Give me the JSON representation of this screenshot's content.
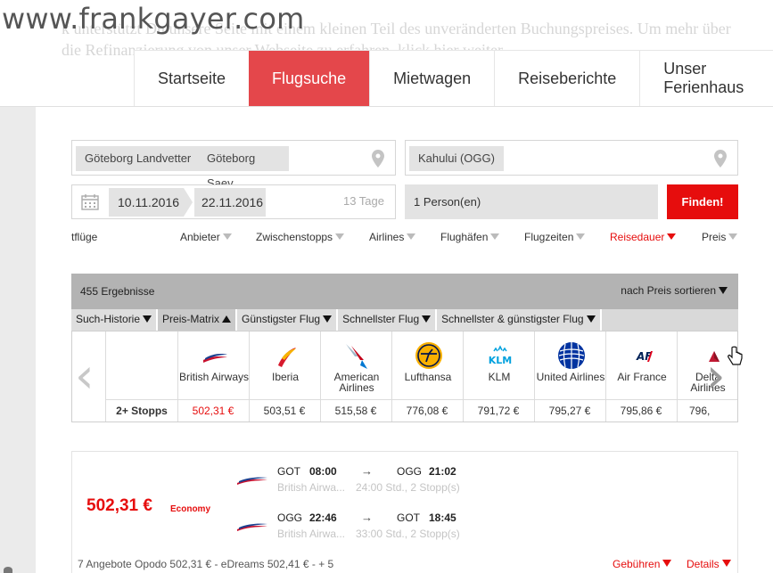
{
  "watermark": "www.frankgayer.com",
  "banner_text": "k unterstützt Du unsere Seite mit einem kleinen Teil des unveränderten Buchungspreises. Um mehr über die Refinanzierung von unser Webseite zu erfahren, klick hier weiter.",
  "nav": {
    "items": [
      {
        "label": "Startseite",
        "active": false
      },
      {
        "label": "Flugsuche",
        "active": true
      },
      {
        "label": "Mietwagen",
        "active": false
      },
      {
        "label": "Reiseberichte",
        "active": false
      },
      {
        "label": "Unser Ferienhaus",
        "active": false
      }
    ]
  },
  "search": {
    "origins": [
      "Göteborg Landvetter",
      "Göteborg Saev"
    ],
    "destination": "Kahului (OGG)",
    "date_from": "10.11.2016",
    "date_to": "22.11.2016",
    "duration": "13 Tage",
    "persons": "1 Person(en)",
    "find_label": "Finden!"
  },
  "filters": [
    {
      "label": "Direktflüge",
      "active": false
    },
    {
      "label": "Anbieter",
      "active": false
    },
    {
      "label": "Zwischenstopps",
      "active": false
    },
    {
      "label": "Airlines",
      "active": false
    },
    {
      "label": "Flughäfen",
      "active": false
    },
    {
      "label": "Flugzeiten",
      "active": false
    },
    {
      "label": "Reisedauer",
      "active": true
    },
    {
      "label": "Preis",
      "active": false
    }
  ],
  "results": {
    "count": "455 Ergebnisse",
    "sort_label": "nach Preis sortieren"
  },
  "tabs": [
    {
      "label": "Such-Historie",
      "arrow": "down",
      "active": false
    },
    {
      "label": "Preis-Matrix",
      "arrow": "up",
      "active": true
    },
    {
      "label": "Günstigster Flug",
      "arrow": "down",
      "active": false
    },
    {
      "label": "Schnellster Flug",
      "arrow": "down",
      "active": false
    },
    {
      "label": "Schnellster & günstigster Flug",
      "arrow": "down",
      "active": false
    }
  ],
  "matrix": {
    "row_label": "2+ Stopps",
    "airlines": [
      {
        "name": "British Airways",
        "price": "502,31 €",
        "best": true,
        "icon": "british-airways-logo"
      },
      {
        "name": "Iberia",
        "price": "503,51 €",
        "best": false,
        "icon": "iberia-logo"
      },
      {
        "name": "American Airlines",
        "price": "515,58 €",
        "best": false,
        "icon": "american-airlines-logo"
      },
      {
        "name": "Lufthansa",
        "price": "776,08 €",
        "best": false,
        "icon": "lufthansa-logo"
      },
      {
        "name": "KLM",
        "price": "791,72 €",
        "best": false,
        "icon": "klm-logo"
      },
      {
        "name": "United Airlines",
        "price": "795,27 €",
        "best": false,
        "icon": "united-airlines-logo"
      },
      {
        "name": "Air France",
        "price": "795,86 €",
        "best": false,
        "icon": "air-france-logo"
      },
      {
        "name": "Delta Airlines",
        "price": "796,",
        "best": false,
        "icon": "delta-logo"
      }
    ]
  },
  "result_card": {
    "price": "502,31 €",
    "cabin": "Economy",
    "segments": [
      {
        "from": "GOT",
        "dep": "08:00",
        "arrow": "→",
        "to": "OGG",
        "arr": "21:02",
        "airline": "British Airwa...",
        "info": "24:00 Std., 2 Stopp(s)"
      },
      {
        "from": "OGG",
        "dep": "22:46",
        "arrow": "→",
        "to": "GOT",
        "arr": "18:45",
        "airline": "British Airwa...",
        "info": "33:00 Std., 2 Stopp(s)"
      }
    ],
    "offers": "7 Angebote  Opodo 502,31 € -  eDreams 502,41 € -  + 5",
    "fees_label": "Gebühren",
    "details_label": "Details"
  },
  "colors": {
    "accent": "#e4474b",
    "price_red": "#e60d0d"
  }
}
